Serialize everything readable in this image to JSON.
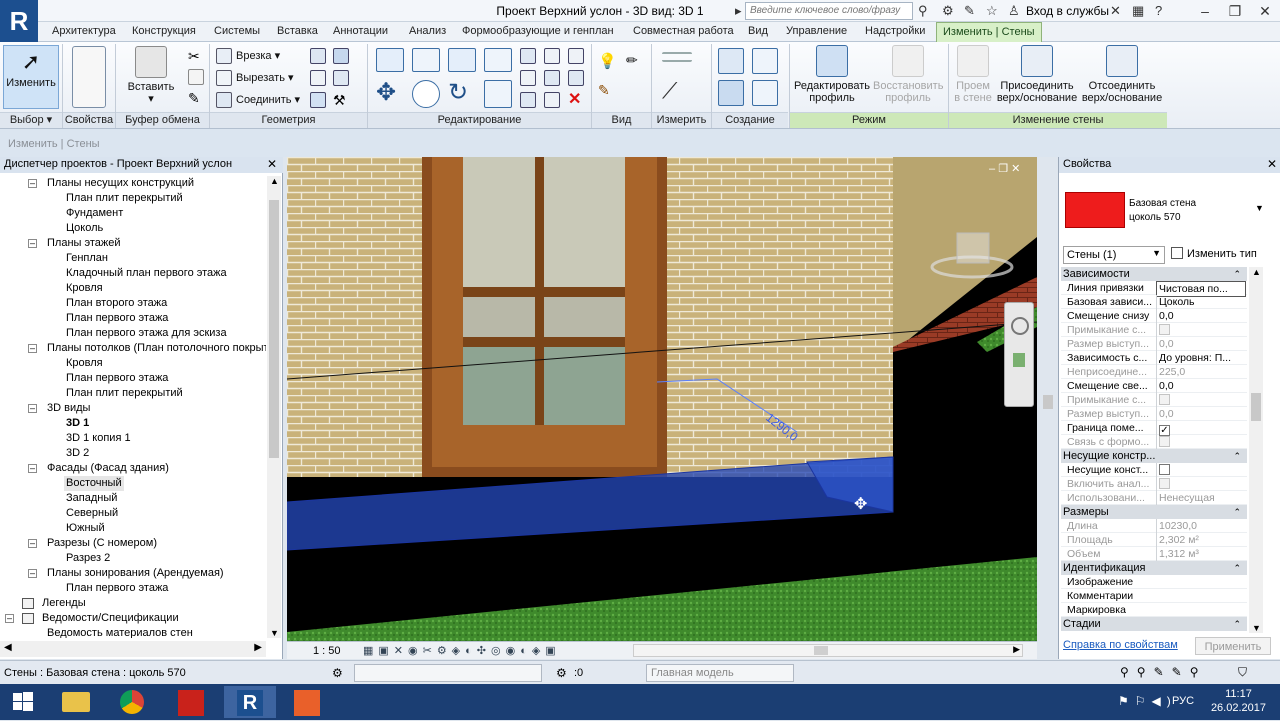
{
  "window": {
    "title": "Проект Верхний услон - 3D вид: 3D 1",
    "search_placeholder": "Введите ключевое слово/фразу",
    "login": "Вход в службы",
    "app_letter": "R"
  },
  "tabs": [
    {
      "label": "Архитектура"
    },
    {
      "label": "Конструкция"
    },
    {
      "label": "Системы"
    },
    {
      "label": "Вставка"
    },
    {
      "label": "Аннотации"
    },
    {
      "label": "Анализ"
    },
    {
      "label": "Формообразующие и генплан"
    },
    {
      "label": "Совместная работа"
    },
    {
      "label": "Вид"
    },
    {
      "label": "Управление"
    },
    {
      "label": "Надстройки"
    },
    {
      "label": "Изменить | Стены"
    }
  ],
  "ribbon": {
    "modify_label": "Изменить",
    "paste_label": "Вставить",
    "cut_label": "Врезка",
    "unjoin_label": "Вырезать",
    "join_label": "Соединить",
    "edit_profile_label": "Редактировать профиль",
    "reset_profile_label": "Восстановить профиль",
    "opening_label": "Проем в стене",
    "attach_label": "Присоединить верх/основание",
    "detach_label": "Отсоединить верх/основание",
    "panels": {
      "select": "Выбор",
      "properties": "Свойства",
      "clipboard": "Буфер обмена",
      "geometry": "Геометрия",
      "modify": "Редактирование",
      "view": "Вид",
      "measure": "Измерить",
      "create": "Создание",
      "mode": "Режим",
      "modify_wall": "Изменение стены"
    }
  },
  "mode_bar": "Изменить | Стены",
  "project_browser": {
    "title": "Диспетчер проектов - Проект Верхний услон",
    "items": [
      {
        "label": "Планы несущих конструкций",
        "level": 1,
        "expanded": true
      },
      {
        "label": "План плит перекрытий",
        "level": 2
      },
      {
        "label": "Фундамент",
        "level": 2
      },
      {
        "label": "Цоколь",
        "level": 2
      },
      {
        "label": "Планы этажей",
        "level": 1,
        "expanded": true
      },
      {
        "label": "Генплан",
        "level": 2
      },
      {
        "label": "Кладочный план первого этажа",
        "level": 2
      },
      {
        "label": "Кровля",
        "level": 2
      },
      {
        "label": "План второго этажа",
        "level": 2
      },
      {
        "label": "План первого этажа",
        "level": 2
      },
      {
        "label": "План первого этажа для эскиза",
        "level": 2
      },
      {
        "label": "Планы потолков (План потолочного покрыти",
        "level": 1,
        "expanded": true
      },
      {
        "label": "Кровля",
        "level": 2
      },
      {
        "label": "План первого этажа",
        "level": 2
      },
      {
        "label": "План плит перекрытий",
        "level": 2
      },
      {
        "label": "3D виды",
        "level": 1,
        "expanded": true
      },
      {
        "label": "3D 1",
        "level": 2,
        "bold": true
      },
      {
        "label": "3D 1 копия 1",
        "level": 2
      },
      {
        "label": "3D 2",
        "level": 2
      },
      {
        "label": "Фасады (Фасад здания)",
        "level": 1,
        "expanded": true
      },
      {
        "label": "Восточный",
        "level": 2,
        "selected": true
      },
      {
        "label": "Западный",
        "level": 2
      },
      {
        "label": "Северный",
        "level": 2
      },
      {
        "label": "Южный",
        "level": 2
      },
      {
        "label": "Разрезы (С номером)",
        "level": 1,
        "expanded": true
      },
      {
        "label": "Разрез 2",
        "level": 2
      },
      {
        "label": "Планы зонирования (Арендуемая)",
        "level": 1,
        "expanded": true
      },
      {
        "label": "План первого этажа",
        "level": 2
      },
      {
        "label": "Легенды",
        "level": 0,
        "icon": true
      },
      {
        "label": "Ведомости/Спецификации",
        "level": 0,
        "icon": true,
        "expanded": true
      },
      {
        "label": "Ведомость материалов стен",
        "level": 1
      }
    ]
  },
  "viewport": {
    "scale": "1 : 50",
    "dimension_text": "1290,0"
  },
  "properties": {
    "title": "Свойства",
    "type_line1": "Базовая стена",
    "type_line2": "цоколь 570",
    "swatch_color": "#ee1c1c",
    "selector": "Стены (1)",
    "edit_type": "Изменить тип",
    "rows": [
      {
        "cat": "Зависимости"
      },
      {
        "k": "Линия привязки",
        "v": "Чистовая по..."
      },
      {
        "k": "Базовая зависи...",
        "v": "Цоколь"
      },
      {
        "k": "Смещение снизу",
        "v": "0,0"
      },
      {
        "k": "Примыкание с...",
        "v": "",
        "dim": true,
        "check": "dim"
      },
      {
        "k": "Размер выступ...",
        "v": "0,0",
        "dim": true
      },
      {
        "k": "Зависимость с...",
        "v": "До уровня: П..."
      },
      {
        "k": "Неприсоедине...",
        "v": "225,0",
        "dim": true
      },
      {
        "k": "Смещение све...",
        "v": "0,0"
      },
      {
        "k": "Примыкание с...",
        "v": "",
        "dim": true,
        "check": "dim"
      },
      {
        "k": "Размер выступ...",
        "v": "0,0",
        "dim": true
      },
      {
        "k": "Граница поме...",
        "v": "",
        "check": "on"
      },
      {
        "k": "Связь с формо...",
        "v": "",
        "dim": true,
        "check": "dim"
      },
      {
        "cat": "Несущие констр..."
      },
      {
        "k": "Несущие конст...",
        "v": "",
        "check": "off"
      },
      {
        "k": "Включить анал...",
        "v": "",
        "dim": true,
        "check": "dim"
      },
      {
        "k": "Использовани...",
        "v": "Ненесущая",
        "dim": true
      },
      {
        "cat": "Размеры"
      },
      {
        "k": "Длина",
        "v": "10230,0",
        "dim": true
      },
      {
        "k": "Площадь",
        "v": "2,302 м²",
        "dim": true
      },
      {
        "k": "Объем",
        "v": "1,312 м³",
        "dim": true
      },
      {
        "cat": "Идентификация"
      },
      {
        "k": "Изображение",
        "v": ""
      },
      {
        "k": "Комментарии",
        "v": ""
      },
      {
        "k": "Маркировка",
        "v": ""
      },
      {
        "cat": "Стадии"
      }
    ],
    "help_link": "Справка по свойствам",
    "apply": "Применить"
  },
  "status": {
    "text": "Стены : Базовая стена : цоколь 570",
    "zero": ":0",
    "model": "Главная модель"
  },
  "taskbar": {
    "lang": "РУС",
    "time": "11:17",
    "date": "26.02.2017"
  }
}
